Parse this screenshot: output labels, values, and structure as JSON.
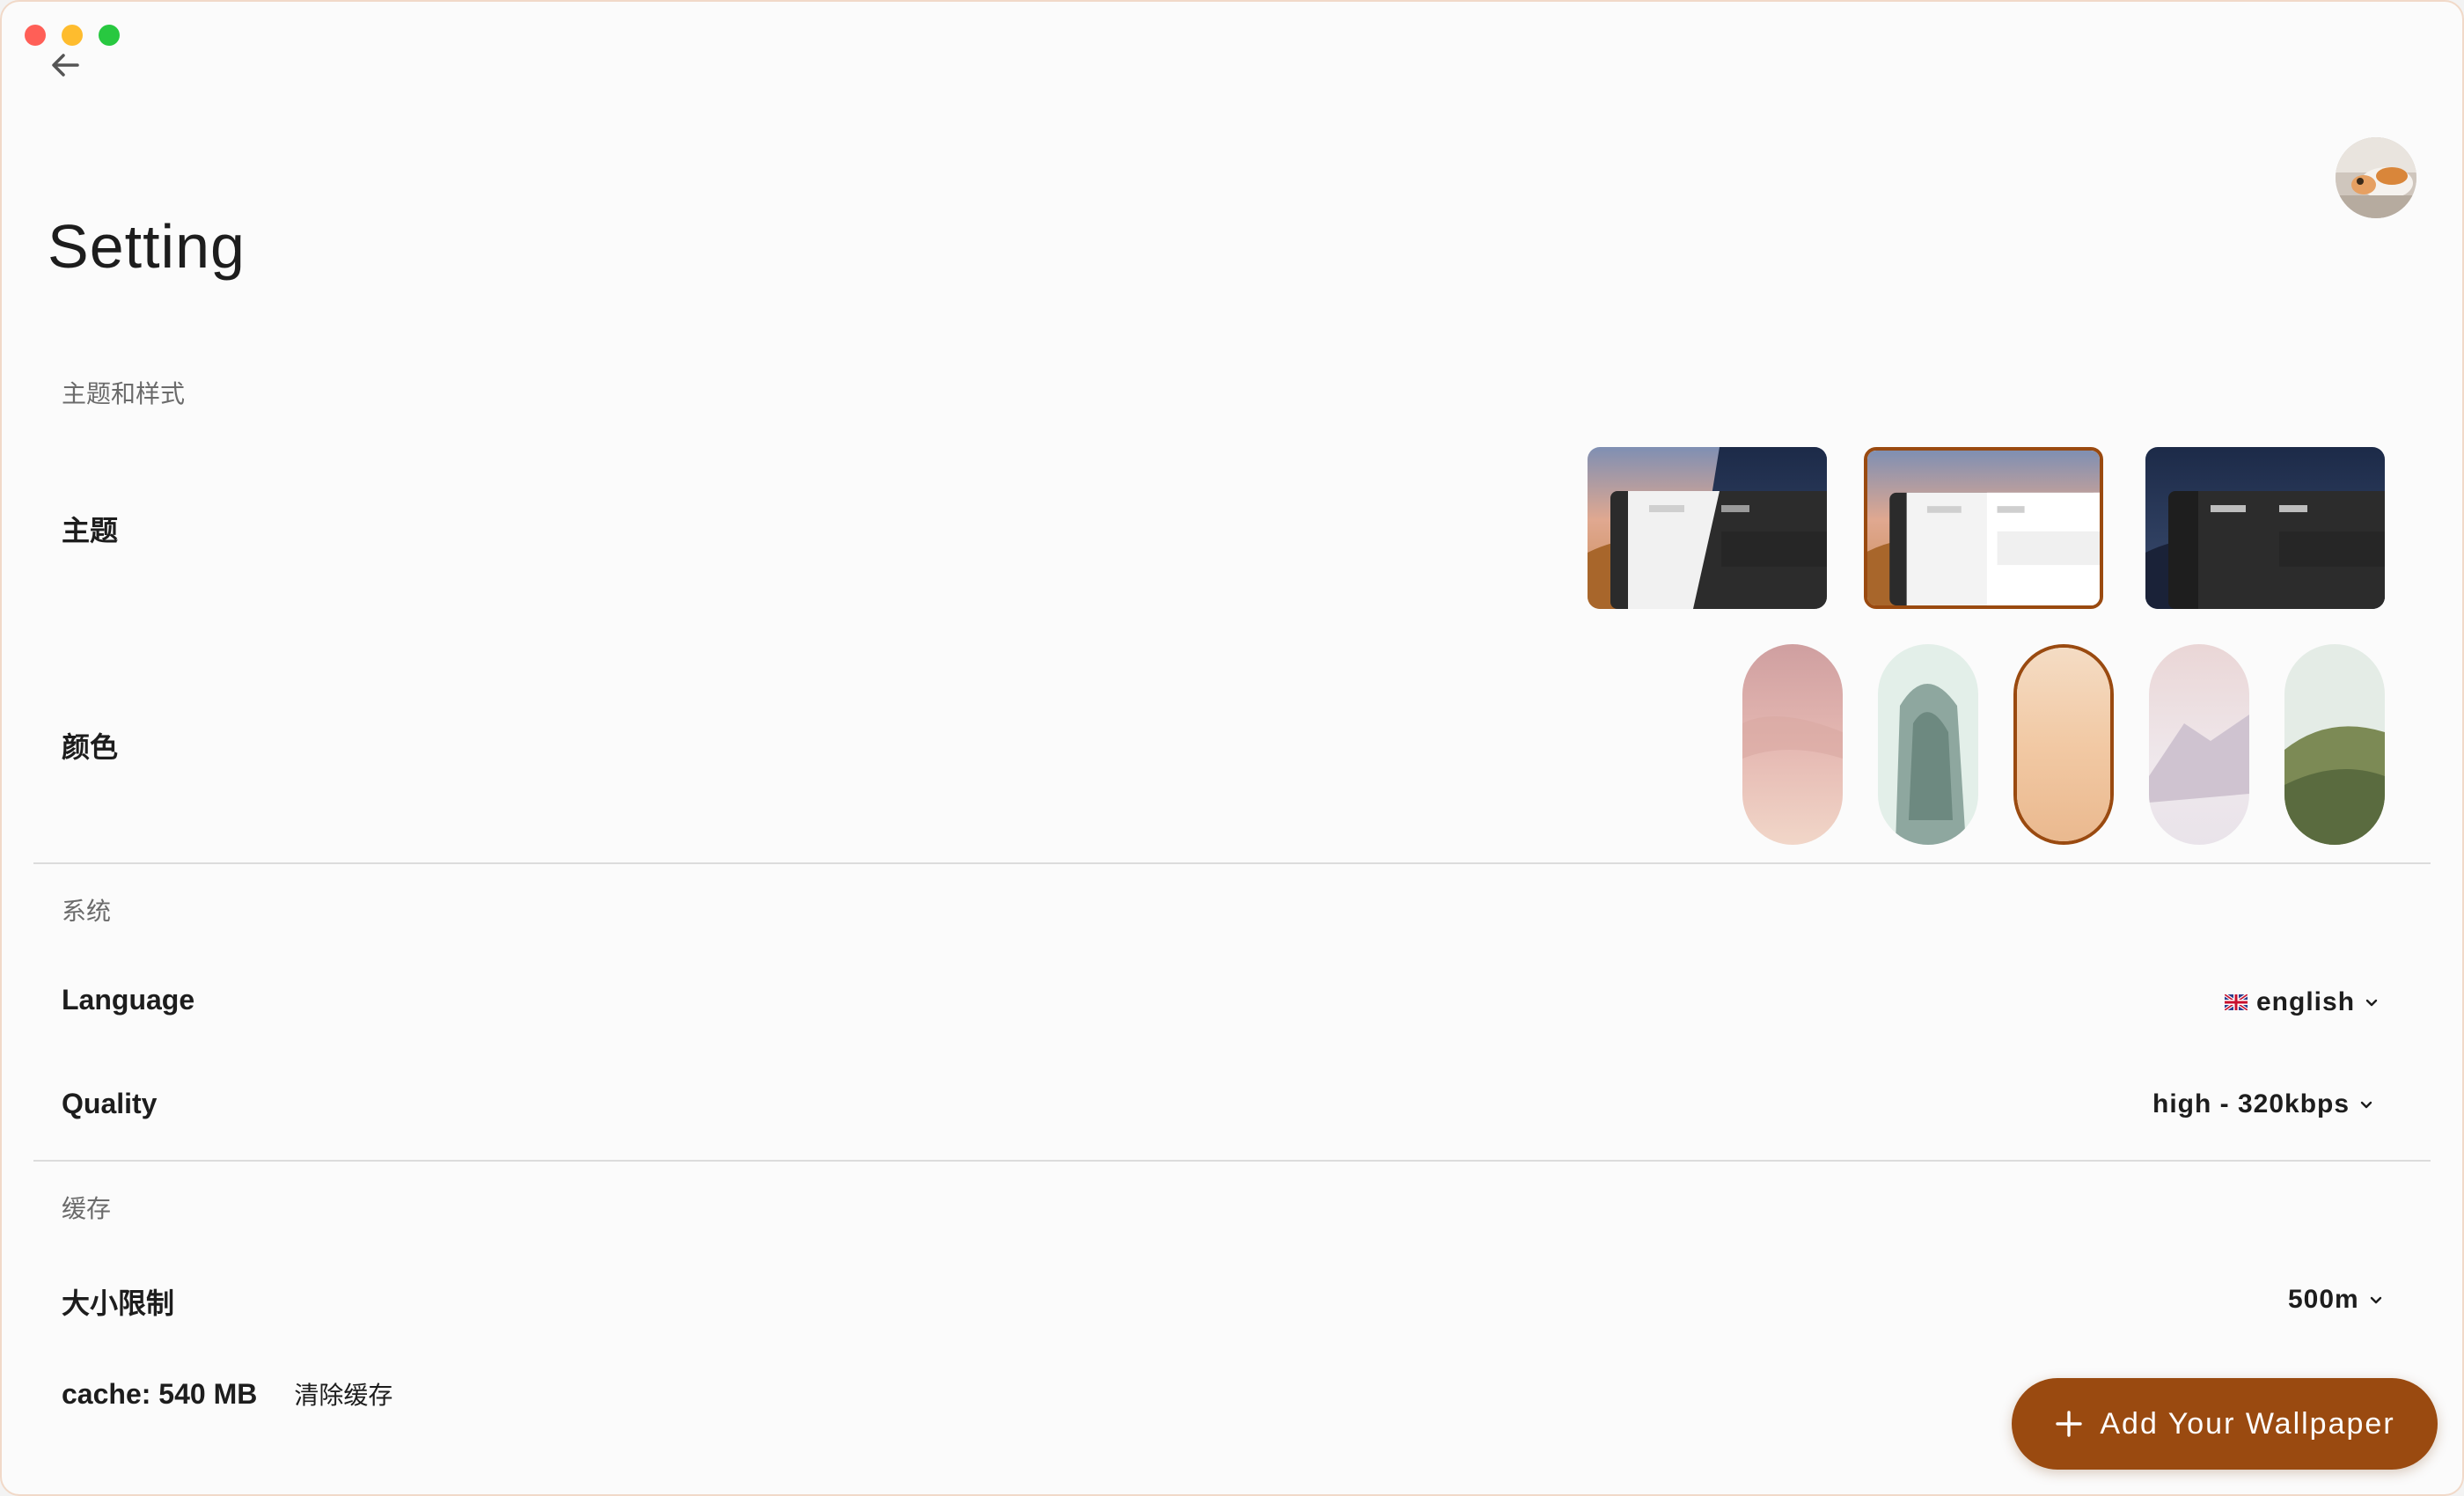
{
  "window": {
    "controls": [
      "close",
      "minimize",
      "zoom"
    ]
  },
  "header": {
    "back_icon": "arrow-left-icon",
    "avatar": "user-avatar"
  },
  "page": {
    "title": "Setting"
  },
  "sections": {
    "theme_style": {
      "label": "主题和样式",
      "theme": {
        "label": "主题",
        "options": [
          "auto",
          "light",
          "dark"
        ],
        "selected": "light"
      },
      "color": {
        "label": "颜色",
        "options": [
          "rose",
          "mint",
          "peach",
          "lilac",
          "olive"
        ],
        "selected": "peach"
      }
    },
    "system": {
      "label": "系统",
      "language": {
        "label": "Language",
        "value": "english",
        "flag_icon": "uk-flag-icon"
      },
      "quality": {
        "label": "Quality",
        "value": "high - 320kbps"
      }
    },
    "cache": {
      "label": "缓存",
      "size_limit": {
        "label": "大小限制",
        "value": "500m"
      },
      "cache_info": {
        "label": "cache: 540 MB",
        "clear_label": "清除缓存"
      }
    }
  },
  "fab": {
    "label": "Add Your Wallpaper",
    "icon": "plus-icon"
  },
  "colors": {
    "accent": "#9a4a10",
    "divider": "#dcdcdc",
    "background": "#fbfbfb"
  }
}
